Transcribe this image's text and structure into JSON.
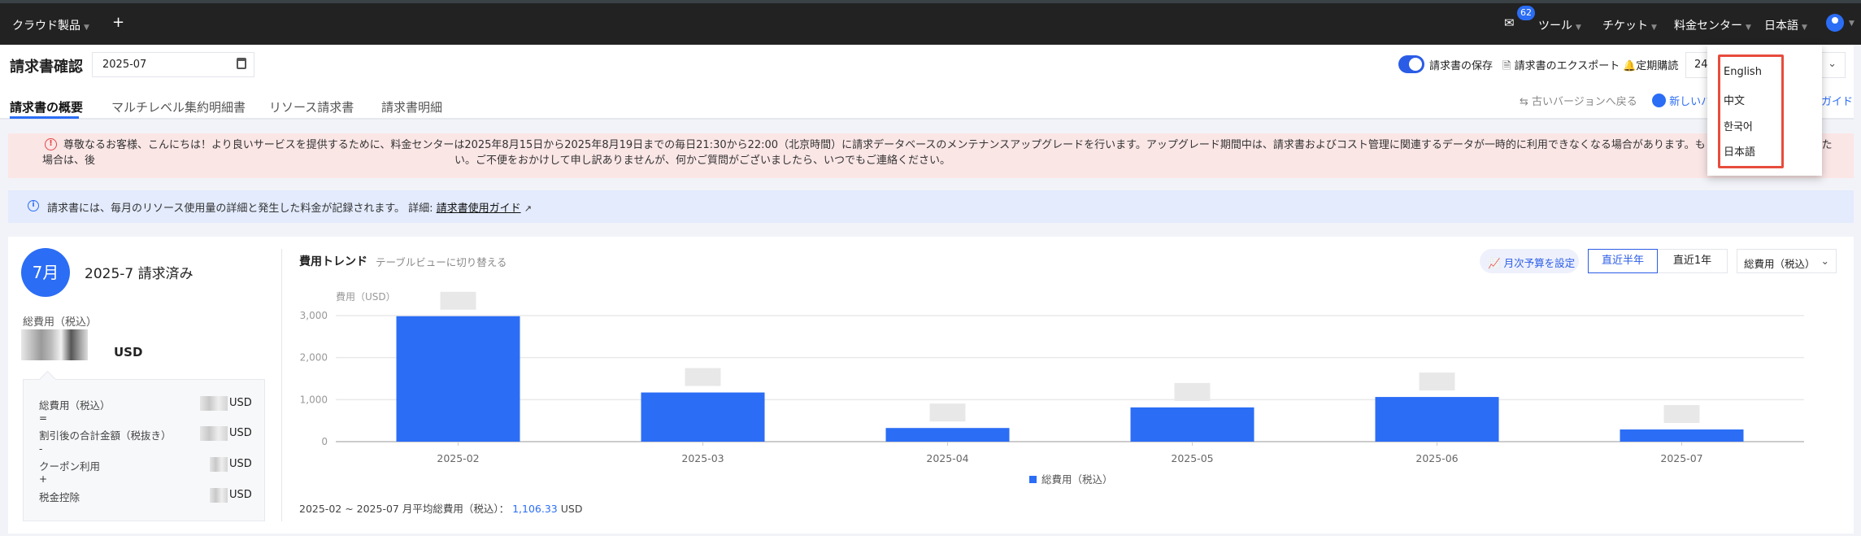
{
  "nav": {
    "products": "クラウド製品",
    "add": "+",
    "mail_badge": "62",
    "tools": "ツール",
    "tickets": "チケット",
    "billing_center": "料金センター",
    "language": "日本語"
  },
  "header": {
    "title": "請求書確認",
    "month": "2025-07",
    "save_invoice": "請求書の保存",
    "export_invoice": "請求書のエクスポート",
    "subscribe": "定期購読",
    "select_value": "24",
    "back_old": "古いバージョンへ戻る",
    "new_version": "新しいバ",
    "guide": "ガイド"
  },
  "tabs": [
    "請求書の概要",
    "マルチレベル集約明細書",
    "リソース請求書",
    "請求書明細"
  ],
  "language_menu": [
    "English",
    "中文",
    "한국어",
    "日本語"
  ],
  "alert": "尊敬なるお客様、こんにちは！より良いサービスを提供するために、料金センターは2025年8月15日から2025年8月19日までの毎日21:30から22:00（北京時間）に請求データベースのメンテナンスアップグレードを行います。アップグレード期間中は、請求書およびコスト管理に関連するデータが一時的に利用できなくなる場合があります。もしクエリエラーが発生した場合は、後　　　　　　　　　　　　　　　　　　　　　　　　　　　　　　　　　　い。ご不便をおかけして申し訳ありませんが、何かご質問がございましたら、いつでもご連絡ください。",
  "info": {
    "text": "請求書には、毎月のリソース使用量の詳細と発生した料金が記録されます。 詳細:",
    "link": "請求書使用ガイド"
  },
  "summary": {
    "month_badge": "7月",
    "title": "2025-7 請求済み",
    "total_label": "総費用（税込）",
    "currency": "USD",
    "breakdown": [
      {
        "label": "総費用（税込）",
        "op": "="
      },
      {
        "label": "割引後の合計金額（税抜き）",
        "op": "-"
      },
      {
        "label": "クーポン利用",
        "op": "+"
      },
      {
        "label": "税金控除",
        "op": ""
      }
    ]
  },
  "trend": {
    "title": "費用トレンド",
    "switch_view": "テーブルビューに切り替える",
    "budget_button": "月次予算を設定",
    "range_half": "直近半年",
    "range_year": "直近1年",
    "metric_select": "総費用（税込）",
    "avg_label": "2025-02 ~ 2025-07 月平均総費用（税込）：",
    "avg_value": "1,106.33",
    "avg_unit": "USD"
  },
  "chart_data": {
    "type": "bar",
    "ylabel": "費用（USD）",
    "categories": [
      "2025-02",
      "2025-03",
      "2025-04",
      "2025-05",
      "2025-06",
      "2025-07"
    ],
    "values": [
      2985,
      1170,
      325,
      815,
      1063,
      290
    ],
    "yticks": [
      "0",
      "1,000",
      "2,000",
      "3,000"
    ],
    "ylim": [
      0,
      3000
    ],
    "legend": "総費用（税込）",
    "legend_position": "bottom",
    "grid": true,
    "color": "#2b6df5"
  }
}
